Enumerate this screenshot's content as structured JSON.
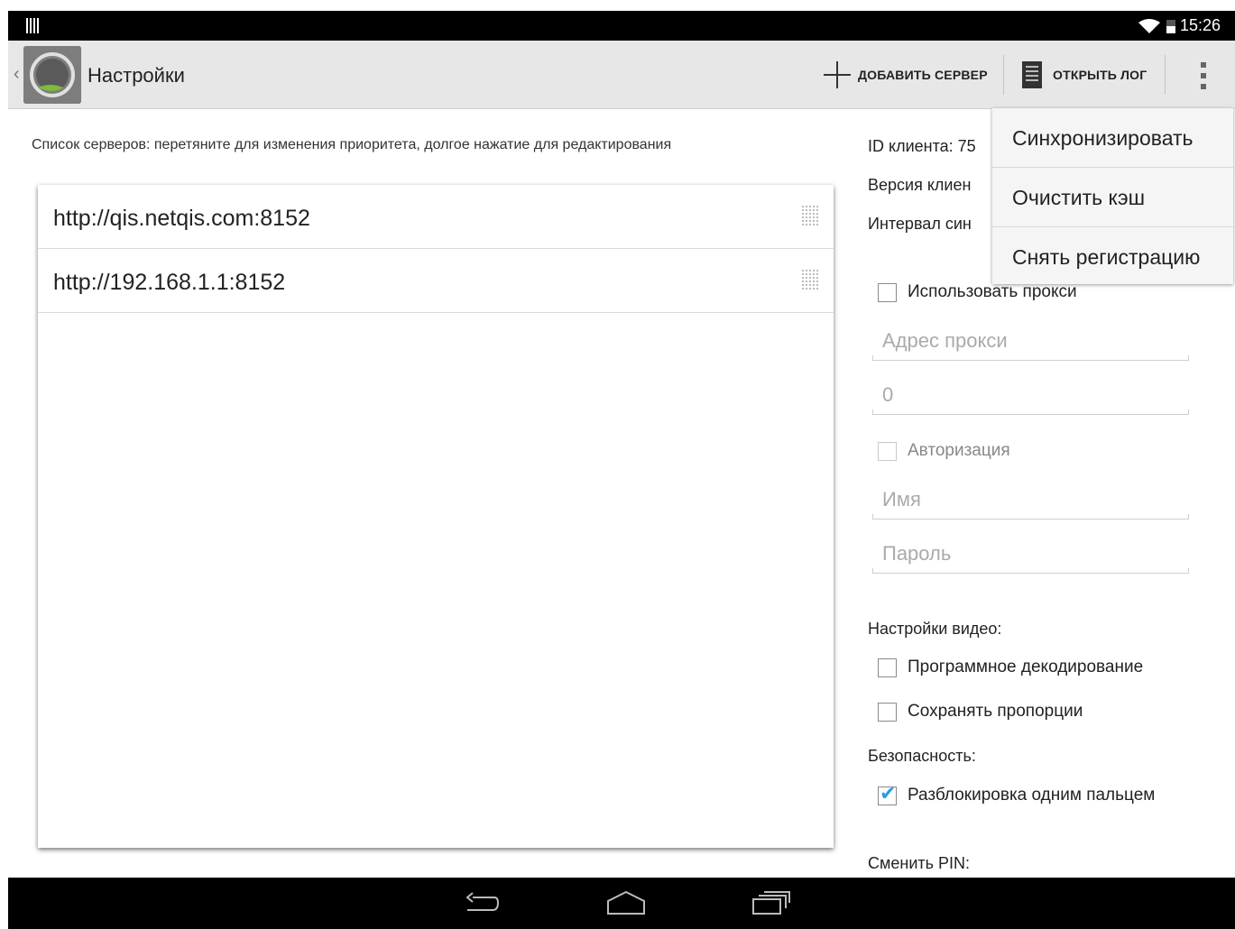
{
  "status_bar": {
    "time": "15:26"
  },
  "action_bar": {
    "title": "Настройки",
    "add_server_label": "ДОБАВИТЬ СЕРВЕР",
    "open_log_label": "ОТКРЫТЬ ЛОГ"
  },
  "servers": {
    "hint": "Список серверов: перетяните для изменения приоритета, долгое нажатие для редактирования",
    "items": [
      {
        "url": "http://qis.netqis.com:8152"
      },
      {
        "url": "http://192.168.1.1:8152"
      }
    ]
  },
  "settings": {
    "client_id_label": "ID клиента: 75",
    "client_version_label": "Версия клиен",
    "sync_interval_label": "Интервал син",
    "use_proxy_label": "Использовать прокси",
    "proxy_address_placeholder": "Адрес прокси",
    "proxy_port_placeholder": "0",
    "auth_label": "Авторизация",
    "name_placeholder": "Имя",
    "password_placeholder": "Пароль",
    "video_header": "Настройки видео:",
    "software_decoding_label": "Программное декодирование",
    "keep_aspect_label": "Сохранять пропорции",
    "security_header": "Безопасность:",
    "one_finger_unlock_label": "Разблокировка одним пальцем",
    "one_finger_unlock_checked": true,
    "change_pin_label": "Сменить PIN:"
  },
  "overflow_menu": {
    "items": [
      "Синхронизировать",
      "Очистить кэш",
      "Снять регистрацию"
    ]
  },
  "colors": {
    "accent": "#2b9fd9",
    "action_bar": "#e7e7e7"
  }
}
